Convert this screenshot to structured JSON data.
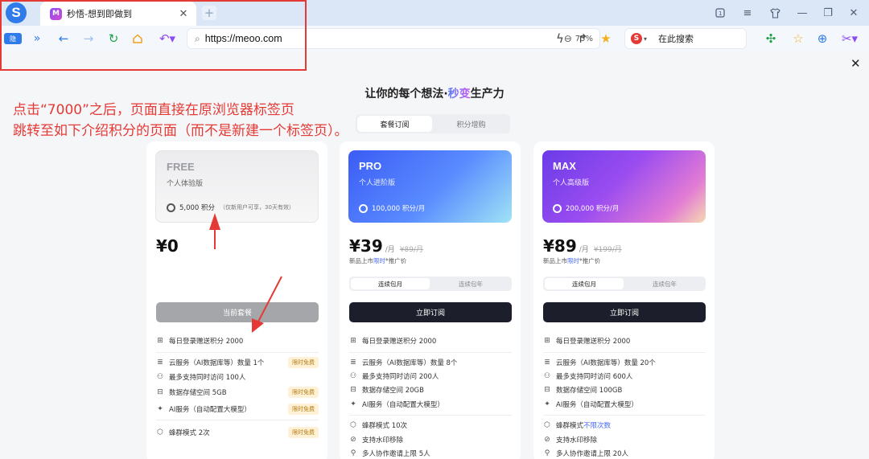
{
  "browser": {
    "logo": "S",
    "tab": {
      "favicon": "M",
      "title": "秒悟-想到即做到"
    },
    "new_tab": "+",
    "address": "https://meoo.com",
    "zoom": "75%",
    "search_engine": "S",
    "search_placeholder": "在此搜索",
    "extension_label": "隐"
  },
  "page": {
    "headline_prefix": "让你的每个想法·",
    "headline_accent": "秒变",
    "headline_suffix": "生产力",
    "tabs": [
      "套餐订阅",
      "积分增购"
    ],
    "active_tab": 0
  },
  "annotation": {
    "text": "点击“7000”之后，页面直接在原浏览器标签页\n跳转至如下介绍积分的页面（而不是新建一个标签页）。",
    "color": "#e53935"
  },
  "plans": [
    {
      "tier": "FREE",
      "subtitle": "个人体验版",
      "credits": "5,000 积分",
      "credits_note": "（仅新用户可享，30天有效）",
      "currency": "¥",
      "price": "0",
      "cta": "当前套餐",
      "features_a": [
        {
          "icon": "gift",
          "text": "每日登录赠送积分 2000"
        }
      ],
      "features_b": [
        {
          "icon": "db",
          "text": "云服务（AI数据库等）数量 1个",
          "badge": "限时免费"
        },
        {
          "icon": "users",
          "text": "最多支持同时访问 100人",
          "badge": ""
        },
        {
          "icon": "drive",
          "text": "数据存储空间 5GB",
          "badge": "限时免费"
        },
        {
          "icon": "ai",
          "text": "AI服务（自动配置大模型）",
          "badge": "限时免费"
        }
      ],
      "features_c": [
        {
          "icon": "hex",
          "text": "蜂群模式 2次",
          "badge": "限时免费"
        }
      ]
    },
    {
      "tier": "PRO",
      "subtitle": "个人进阶版",
      "credits": "100,000 积分/月",
      "currency": "¥",
      "price": "39",
      "unit": "/月",
      "orig": "¥89/月",
      "promo_a": "新品上市",
      "promo_hl": "限时",
      "promo_b": "*推广价",
      "periods": [
        "连续包月",
        "连续包年"
      ],
      "cta": "立即订阅",
      "features_a": [
        {
          "icon": "gift",
          "text": "每日登录赠送积分 2000"
        }
      ],
      "features_b": [
        {
          "icon": "db",
          "text": "云服务（AI数据库等）数量 8个"
        },
        {
          "icon": "users",
          "text": "最多支持同时访问 200人"
        },
        {
          "icon": "drive",
          "text": "数据存储空间 20GB"
        },
        {
          "icon": "ai",
          "text": "AI服务（自动配置大模型）"
        }
      ],
      "features_c": [
        {
          "icon": "hex",
          "text": "蜂群模式 10次"
        },
        {
          "icon": "eye",
          "text": "支持水印移除"
        },
        {
          "icon": "user-add",
          "text": "多人协作邀请上限 5人"
        }
      ]
    },
    {
      "tier": "MAX",
      "subtitle": "个人高级版",
      "credits": "200,000 积分/月",
      "currency": "¥",
      "price": "89",
      "unit": "/月",
      "orig": "¥199/月",
      "promo_a": "新品上市",
      "promo_hl": "限时",
      "promo_b": "*推广价",
      "periods": [
        "连续包月",
        "连续包年"
      ],
      "cta": "立即订阅",
      "features_a": [
        {
          "icon": "gift",
          "text": "每日登录赠送积分 2000"
        }
      ],
      "features_b": [
        {
          "icon": "db",
          "text": "云服务（AI数据库等）数量 20个"
        },
        {
          "icon": "users",
          "text": "最多支持同时访问 600人"
        },
        {
          "icon": "drive",
          "text": "数据存储空间 100GB"
        },
        {
          "icon": "ai",
          "text": "AI服务（自动配置大模型）"
        }
      ],
      "features_c": [
        {
          "icon": "hex",
          "text": "蜂群模式 ",
          "hl": "不限次数"
        },
        {
          "icon": "eye",
          "text": "支持水印移除"
        },
        {
          "icon": "user-add",
          "text": "多人协作邀请上限 20人"
        }
      ]
    }
  ]
}
